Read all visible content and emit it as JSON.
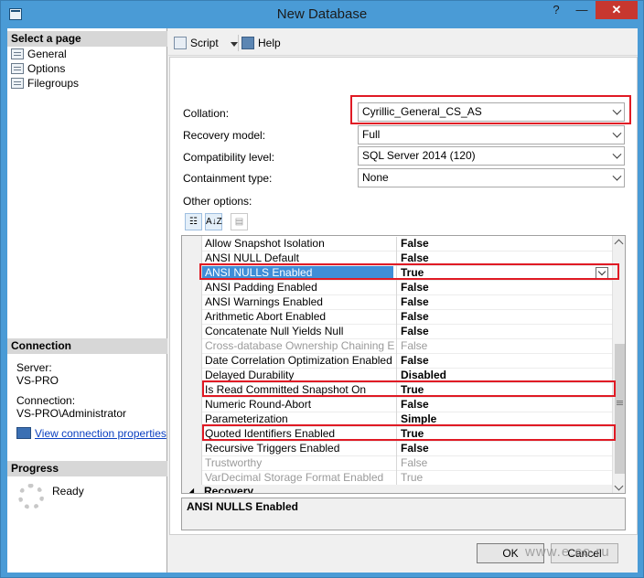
{
  "window": {
    "title": "New Database",
    "help_glyph": "?",
    "min_glyph": "—",
    "close_glyph": "✕"
  },
  "left": {
    "select_header": "Select a page",
    "pages": [
      "General",
      "Options",
      "Filegroups"
    ],
    "connection_header": "Connection",
    "server_label": "Server:",
    "server_value": "VS-PRO",
    "connection_label": "Connection:",
    "connection_value": "VS-PRO\\Administrator",
    "view_link": "View connection properties",
    "progress_header": "Progress",
    "progress_status": "Ready"
  },
  "toolbar": {
    "script": "Script",
    "help": "Help"
  },
  "form": {
    "collation_label": "Collation:",
    "collation_value": "Cyrillic_General_CS_AS",
    "recovery_label": "Recovery model:",
    "recovery_value": "Full",
    "compat_label": "Compatibility level:",
    "compat_value": "SQL Server 2014 (120)",
    "containment_label": "Containment type:",
    "containment_value": "None",
    "other_label": "Other options:"
  },
  "sort_buttons": {
    "categorized": "☷",
    "alphabetical": "A↓Z",
    "pages": "▤"
  },
  "grid": {
    "rows": [
      {
        "name": "Allow Snapshot Isolation",
        "value": "False",
        "disabled": false
      },
      {
        "name": "ANSI NULL Default",
        "value": "False",
        "disabled": false
      },
      {
        "name": "ANSI NULLS Enabled",
        "value": "True",
        "disabled": false,
        "selected": true
      },
      {
        "name": "ANSI Padding Enabled",
        "value": "False",
        "disabled": false
      },
      {
        "name": "ANSI Warnings Enabled",
        "value": "False",
        "disabled": false
      },
      {
        "name": "Arithmetic Abort Enabled",
        "value": "False",
        "disabled": false
      },
      {
        "name": "Concatenate Null Yields Null",
        "value": "False",
        "disabled": false
      },
      {
        "name": "Cross-database Ownership Chaining Enabled",
        "value": "False",
        "disabled": true
      },
      {
        "name": "Date Correlation Optimization Enabled",
        "value": "False",
        "disabled": false
      },
      {
        "name": "Delayed Durability",
        "value": "Disabled",
        "disabled": false
      },
      {
        "name": "Is Read Committed Snapshot On",
        "value": "True",
        "disabled": false
      },
      {
        "name": "Numeric Round-Abort",
        "value": "False",
        "disabled": false
      },
      {
        "name": "Parameterization",
        "value": "Simple",
        "disabled": false
      },
      {
        "name": "Quoted Identifiers Enabled",
        "value": "True",
        "disabled": false
      },
      {
        "name": "Recursive Triggers Enabled",
        "value": "False",
        "disabled": false
      },
      {
        "name": "Trustworthy",
        "value": "False",
        "disabled": true
      },
      {
        "name": "VarDecimal Storage Format Enabled",
        "value": "True",
        "disabled": true
      }
    ],
    "category": "Recovery",
    "category_glyph": "◢"
  },
  "description": {
    "title": "ANSI NULLS Enabled"
  },
  "buttons": {
    "ok": "OK",
    "cancel": "Cancel"
  },
  "watermark": "www.e.co.ru",
  "colors": {
    "highlight_box": "#e01a24",
    "selection": "#3f8ed8",
    "title_bar": "#4a9bd6"
  }
}
